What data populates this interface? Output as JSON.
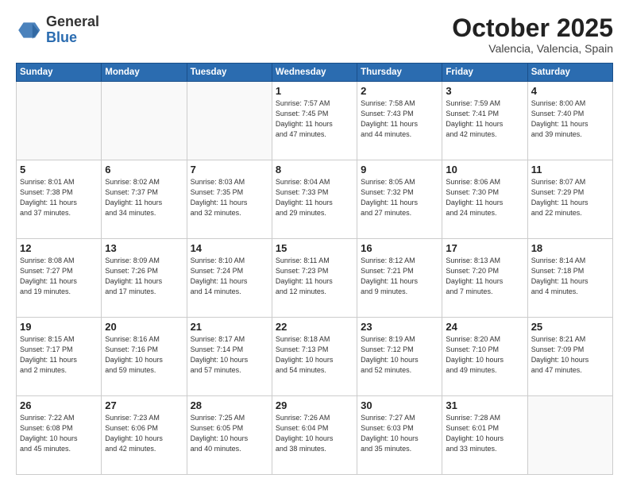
{
  "header": {
    "logo_general": "General",
    "logo_blue": "Blue",
    "month_title": "October 2025",
    "subtitle": "Valencia, Valencia, Spain"
  },
  "weekdays": [
    "Sunday",
    "Monday",
    "Tuesday",
    "Wednesday",
    "Thursday",
    "Friday",
    "Saturday"
  ],
  "weeks": [
    [
      {
        "day": "",
        "info": ""
      },
      {
        "day": "",
        "info": ""
      },
      {
        "day": "",
        "info": ""
      },
      {
        "day": "1",
        "info": "Sunrise: 7:57 AM\nSunset: 7:45 PM\nDaylight: 11 hours\nand 47 minutes."
      },
      {
        "day": "2",
        "info": "Sunrise: 7:58 AM\nSunset: 7:43 PM\nDaylight: 11 hours\nand 44 minutes."
      },
      {
        "day": "3",
        "info": "Sunrise: 7:59 AM\nSunset: 7:41 PM\nDaylight: 11 hours\nand 42 minutes."
      },
      {
        "day": "4",
        "info": "Sunrise: 8:00 AM\nSunset: 7:40 PM\nDaylight: 11 hours\nand 39 minutes."
      }
    ],
    [
      {
        "day": "5",
        "info": "Sunrise: 8:01 AM\nSunset: 7:38 PM\nDaylight: 11 hours\nand 37 minutes."
      },
      {
        "day": "6",
        "info": "Sunrise: 8:02 AM\nSunset: 7:37 PM\nDaylight: 11 hours\nand 34 minutes."
      },
      {
        "day": "7",
        "info": "Sunrise: 8:03 AM\nSunset: 7:35 PM\nDaylight: 11 hours\nand 32 minutes."
      },
      {
        "day": "8",
        "info": "Sunrise: 8:04 AM\nSunset: 7:33 PM\nDaylight: 11 hours\nand 29 minutes."
      },
      {
        "day": "9",
        "info": "Sunrise: 8:05 AM\nSunset: 7:32 PM\nDaylight: 11 hours\nand 27 minutes."
      },
      {
        "day": "10",
        "info": "Sunrise: 8:06 AM\nSunset: 7:30 PM\nDaylight: 11 hours\nand 24 minutes."
      },
      {
        "day": "11",
        "info": "Sunrise: 8:07 AM\nSunset: 7:29 PM\nDaylight: 11 hours\nand 22 minutes."
      }
    ],
    [
      {
        "day": "12",
        "info": "Sunrise: 8:08 AM\nSunset: 7:27 PM\nDaylight: 11 hours\nand 19 minutes."
      },
      {
        "day": "13",
        "info": "Sunrise: 8:09 AM\nSunset: 7:26 PM\nDaylight: 11 hours\nand 17 minutes."
      },
      {
        "day": "14",
        "info": "Sunrise: 8:10 AM\nSunset: 7:24 PM\nDaylight: 11 hours\nand 14 minutes."
      },
      {
        "day": "15",
        "info": "Sunrise: 8:11 AM\nSunset: 7:23 PM\nDaylight: 11 hours\nand 12 minutes."
      },
      {
        "day": "16",
        "info": "Sunrise: 8:12 AM\nSunset: 7:21 PM\nDaylight: 11 hours\nand 9 minutes."
      },
      {
        "day": "17",
        "info": "Sunrise: 8:13 AM\nSunset: 7:20 PM\nDaylight: 11 hours\nand 7 minutes."
      },
      {
        "day": "18",
        "info": "Sunrise: 8:14 AM\nSunset: 7:18 PM\nDaylight: 11 hours\nand 4 minutes."
      }
    ],
    [
      {
        "day": "19",
        "info": "Sunrise: 8:15 AM\nSunset: 7:17 PM\nDaylight: 11 hours\nand 2 minutes."
      },
      {
        "day": "20",
        "info": "Sunrise: 8:16 AM\nSunset: 7:16 PM\nDaylight: 10 hours\nand 59 minutes."
      },
      {
        "day": "21",
        "info": "Sunrise: 8:17 AM\nSunset: 7:14 PM\nDaylight: 10 hours\nand 57 minutes."
      },
      {
        "day": "22",
        "info": "Sunrise: 8:18 AM\nSunset: 7:13 PM\nDaylight: 10 hours\nand 54 minutes."
      },
      {
        "day": "23",
        "info": "Sunrise: 8:19 AM\nSunset: 7:12 PM\nDaylight: 10 hours\nand 52 minutes."
      },
      {
        "day": "24",
        "info": "Sunrise: 8:20 AM\nSunset: 7:10 PM\nDaylight: 10 hours\nand 49 minutes."
      },
      {
        "day": "25",
        "info": "Sunrise: 8:21 AM\nSunset: 7:09 PM\nDaylight: 10 hours\nand 47 minutes."
      }
    ],
    [
      {
        "day": "26",
        "info": "Sunrise: 7:22 AM\nSunset: 6:08 PM\nDaylight: 10 hours\nand 45 minutes."
      },
      {
        "day": "27",
        "info": "Sunrise: 7:23 AM\nSunset: 6:06 PM\nDaylight: 10 hours\nand 42 minutes."
      },
      {
        "day": "28",
        "info": "Sunrise: 7:25 AM\nSunset: 6:05 PM\nDaylight: 10 hours\nand 40 minutes."
      },
      {
        "day": "29",
        "info": "Sunrise: 7:26 AM\nSunset: 6:04 PM\nDaylight: 10 hours\nand 38 minutes."
      },
      {
        "day": "30",
        "info": "Sunrise: 7:27 AM\nSunset: 6:03 PM\nDaylight: 10 hours\nand 35 minutes."
      },
      {
        "day": "31",
        "info": "Sunrise: 7:28 AM\nSunset: 6:01 PM\nDaylight: 10 hours\nand 33 minutes."
      },
      {
        "day": "",
        "info": ""
      }
    ]
  ]
}
